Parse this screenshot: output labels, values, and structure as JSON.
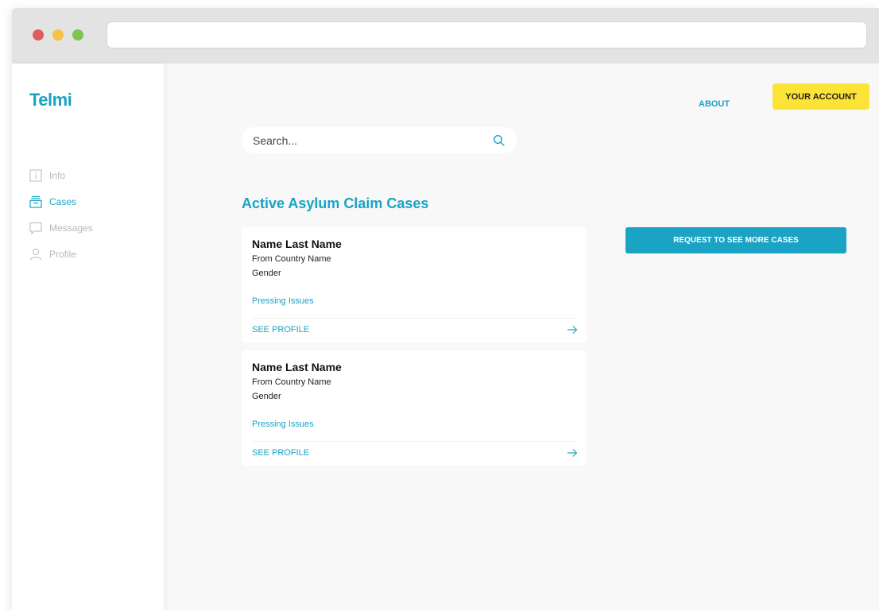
{
  "app": {
    "logo": "Telmi"
  },
  "nav": {
    "items": [
      {
        "label": "Info",
        "icon": "info-icon",
        "active": false
      },
      {
        "label": "Cases",
        "icon": "cases-icon",
        "active": true
      },
      {
        "label": "Messages",
        "icon": "message-icon",
        "active": false
      },
      {
        "label": "Profile",
        "icon": "user-icon",
        "active": false
      }
    ]
  },
  "header": {
    "about": "ABOUT",
    "account": "YOUR ACCOUNT"
  },
  "search": {
    "placeholder": "Search..."
  },
  "main": {
    "heading": "Active Asylum Claim Cases",
    "request_button": "REQUEST TO SEE MORE CASES",
    "cases": [
      {
        "name": "Name Last Name",
        "country": "From Country Name",
        "gender": "Gender",
        "issues": "Pressing Issues",
        "action": "SEE PROFILE"
      },
      {
        "name": "Name Last Name",
        "country": "From Country Name",
        "gender": "Gender",
        "issues": "Pressing Issues",
        "action": "SEE PROFILE"
      }
    ]
  },
  "colors": {
    "accent": "#1aa3c4",
    "account_button": "#fbe338",
    "inactive": "#b8b8b8"
  }
}
